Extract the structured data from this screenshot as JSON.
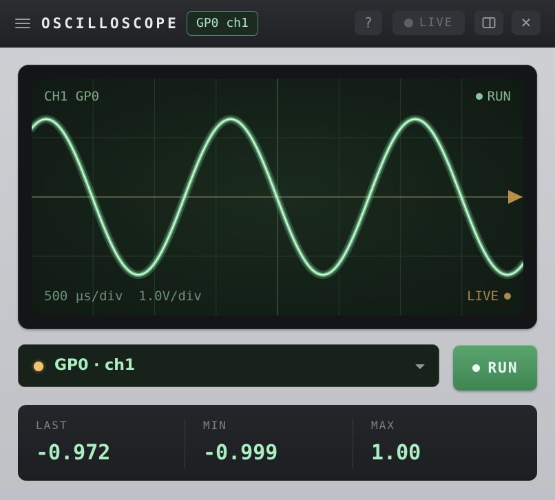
{
  "titlebar": {
    "title": "OSCILLOSCOPE",
    "channel_badge": "GP0 ch1",
    "help_label": "?",
    "live_label": "LIVE",
    "close_label": "✕"
  },
  "screen": {
    "channel_label": "CH1 GP0",
    "run_label": "RUN",
    "timebase": "500 µs/div",
    "volts_per_div": "1.0V/div",
    "live_label": "LIVE",
    "trace_color": "#8ff0ac",
    "trigger_color": "#d4a24c"
  },
  "channel_select": {
    "value": "GP0 · ch1",
    "dot_color": "#f2c46b"
  },
  "run_button": {
    "label": "RUN"
  },
  "stats": [
    {
      "label": "LAST",
      "value": "-0.972"
    },
    {
      "label": "MIN",
      "value": "-0.999"
    },
    {
      "label": "MAX",
      "value": "1.00"
    }
  ]
}
